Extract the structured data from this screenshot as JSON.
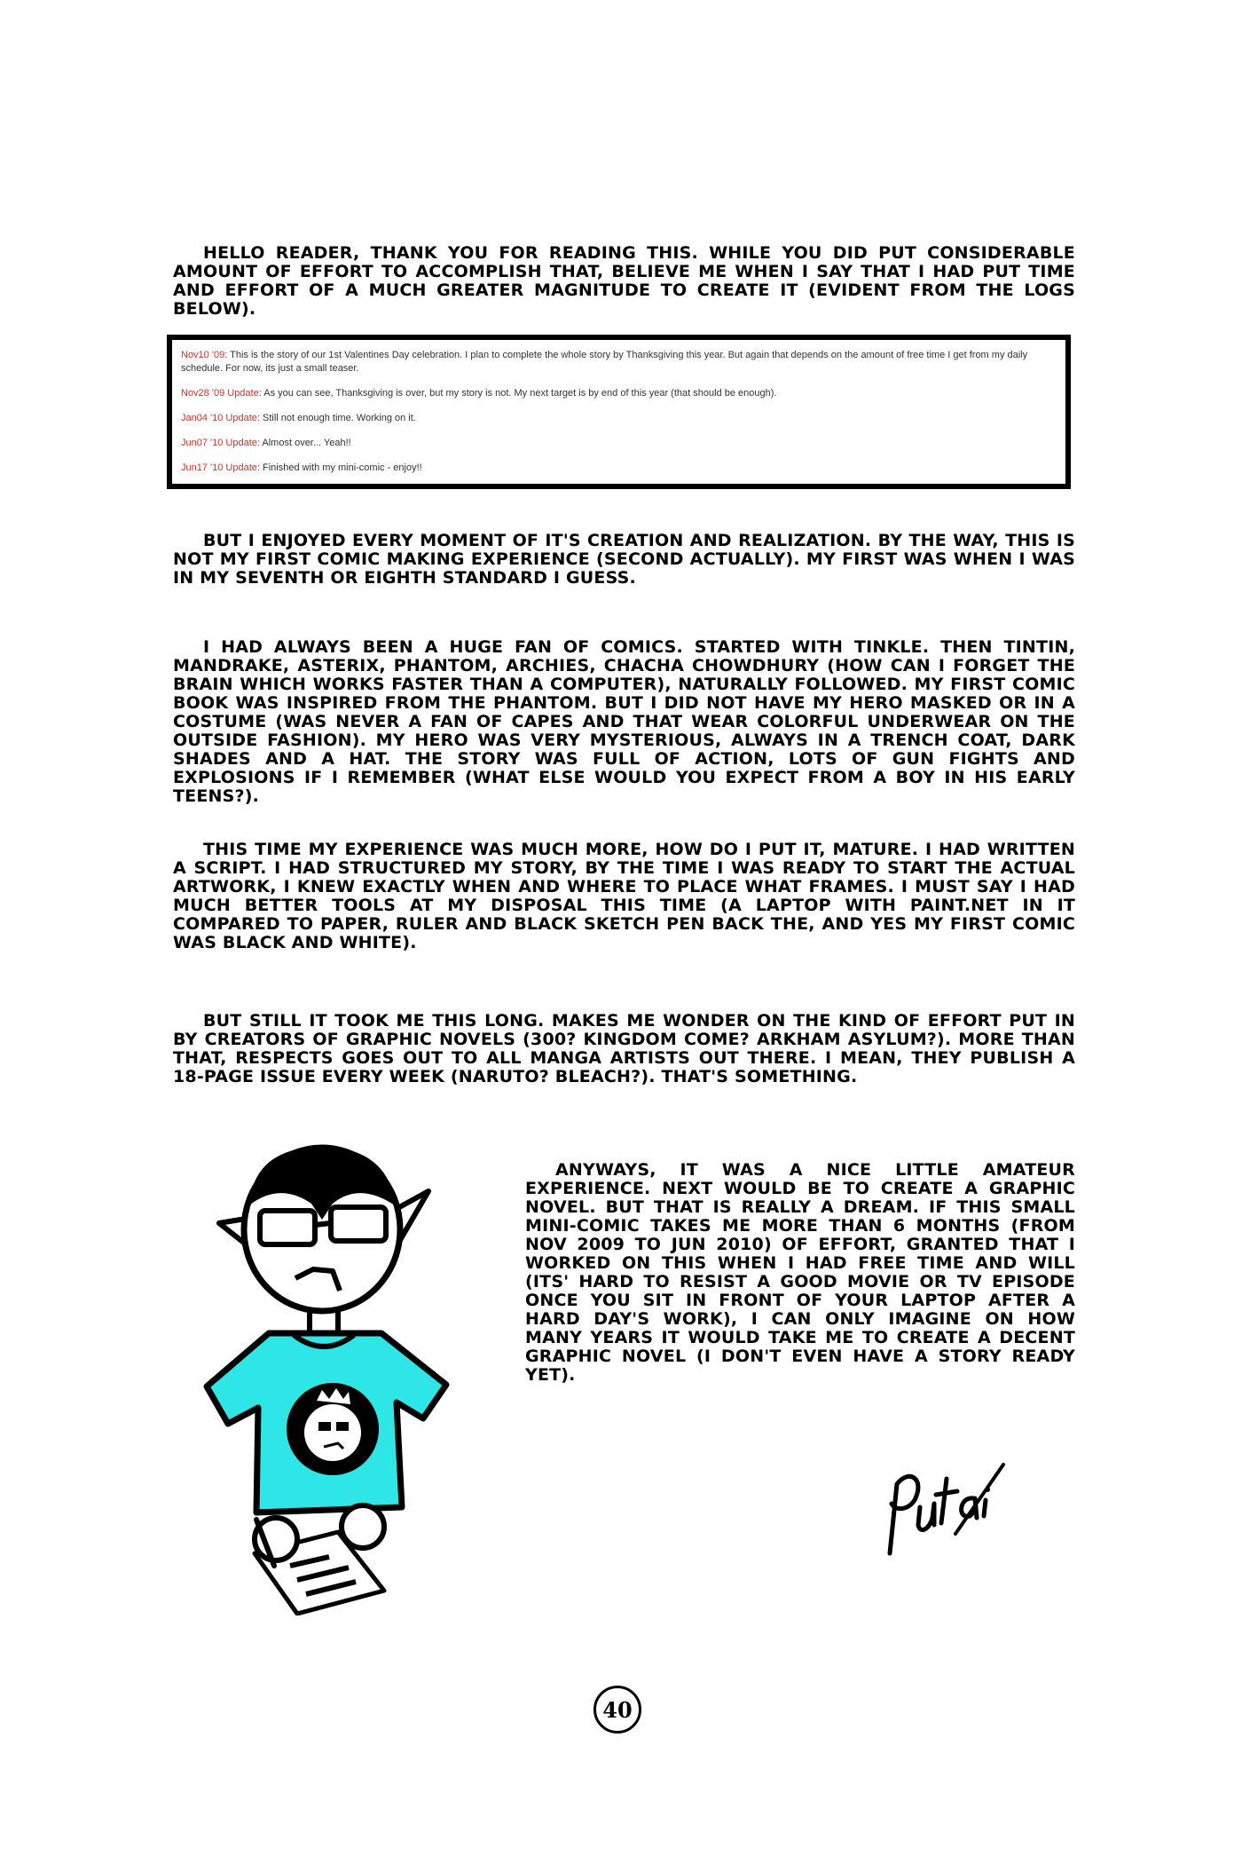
{
  "paragraphs": {
    "intro": "Hello reader, thank you for reading this. While you did put considerable amount of effort to accomplish that, believe me when I say that I had put time and effort of a much greater magnitude to create it (evident from the logs below).",
    "enjoyed": "But I enjoyed every moment of it's creation and realization. By the way, this is not my first comic making experience (second actually). My first was when I was in my seventh or eighth standard I guess.",
    "fan": "I had always been a huge fan of comics. Started with Tinkle. Then Tintin, Mandrake, Asterix, Phantom, Archies, Chacha Chowdhury (how can I forget the brain which works faster than a computer), naturally followed. My first comic book was inspired from the Phantom. But I did not have my hero masked or in a costume (was never a fan of capes and that wear colorful underwear on the outside fashion). My hero was very mysterious, always in a trench coat, dark shades and a hat. The story was full of action, lots of gun fights and explosions if I remember (what else would you expect from a boy in his early teens?).",
    "mature": "This time my experience was much more, how do I put it, mature. I had written a script. I had structured my story, by the time I was ready to start the actual artwork, I knew exactly when and where to place what frames. I must say I had much better tools at my disposal this time (a laptop with Paint.NET in it compared to paper, ruler and black sketch pen back the, and yes my first comic was black and white).",
    "long": "But still it took me this long. Makes me wonder on the kind of effort put in by creators of graphic novels (300? Kingdom Come? Arkham Asylum?). More than that, respects goes out to all manga artists out there. I mean, they publish a 18-page issue every week (Naruto? Bleach?). That's something.",
    "anyways": "Anyways, it was a nice little amateur experience. Next would be to create a graphic novel. But that is really a dream. If this small mini-comic takes me more than 6 months (from Nov 2009 to Jun 2010) of effort, granted that I worked on this when I had free time and will (its' hard to resist a good movie or TV episode once you sit in front of your laptop after a hard day's work), I can only imagine on how many years it would take me to create a decent graphic novel (I don't even have a story ready yet)."
  },
  "logs": [
    {
      "date": "Nov10 '09:",
      "text": " This is the story of our 1st Valentines Day celebration. I plan to complete the whole story by Thanksgiving this year. But again that depends on the amount of free time I get from my daily schedule. For now, its just a small teaser."
    },
    {
      "date": "Nov28 '09 Update:",
      "text": " As you can see, Thanksgiving is over, but my story is not. My next target is by end of this year (that should be enough)."
    },
    {
      "date": "Jan04 '10 Update:",
      "text": " Still not enough time. Working on it."
    },
    {
      "date": "Jun07 '10 Update:",
      "text": " Almost over... Yeah!!"
    },
    {
      "date": "Jun17 '10 Update:",
      "text": " Finished with my mini-comic - enjoy!!"
    }
  ],
  "signature": "Putai",
  "page_number": "40",
  "colors": {
    "shirt": "#2ee6e6",
    "log_date": "#c0392b",
    "log_text": "#333333"
  }
}
